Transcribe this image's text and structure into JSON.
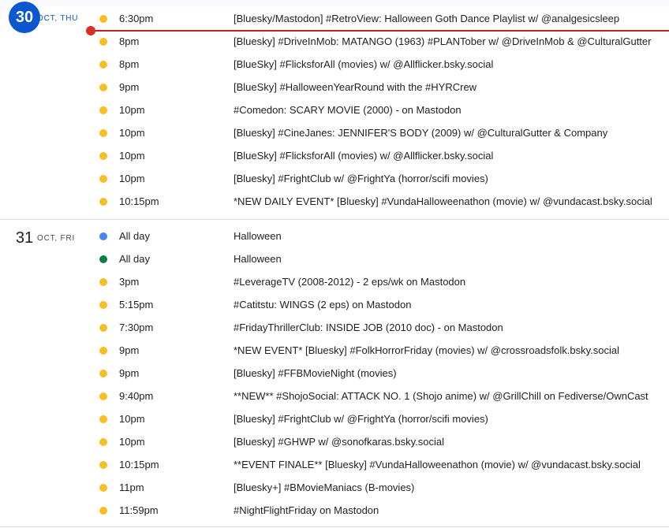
{
  "colors": {
    "yellow": "#f6bf26",
    "blue": "#4285f4",
    "green": "#0b8043",
    "today": "#0b57d0",
    "now": "#d93025"
  },
  "days": [
    {
      "num": "30",
      "label": "Oct, Thu",
      "events": [
        {
          "time": "6:30pm",
          "title": "[Bluesky/Mastodon] #RetroView: Halloween Goth Dance Playlist w/ @analgesicsleep",
          "color": "#f6bf26"
        },
        {
          "time": "8pm",
          "title": "[Bluesky] #DriveInMob: MATANGO (1963) #PLANTober w/ @DriveInMob & @CulturalGutter",
          "color": "#f6bf26"
        },
        {
          "time": "8pm",
          "title": "[BlueSky] #FlicksforAll (movies) w/ @Allflicker.bsky.social",
          "color": "#f6bf26"
        },
        {
          "time": "9pm",
          "title": "[BlueSky] #HalloweenYearRound with the #HYRCrew",
          "color": "#f6bf26"
        },
        {
          "time": "10pm",
          "title": "#Comedon: SCARY MOVIE (2000) - on Mastodon",
          "color": "#f6bf26"
        },
        {
          "time": "10pm",
          "title": "[Bluesky] #CineJanes: JENNIFER'S BODY (2009) w/ @CulturalGutter & Company",
          "color": "#f6bf26"
        },
        {
          "time": "10pm",
          "title": "[BlueSky] #FlicksforAll (movies) w/ @Allflicker.bsky.social",
          "color": "#f6bf26"
        },
        {
          "time": "10pm",
          "title": "[Bluesky] #FrightClub w/ @FrightYa (horror/scifi movies)",
          "color": "#f6bf26"
        },
        {
          "time": "10:15pm",
          "title": "*NEW DAILY EVENT* [Bluesky] #VundaHalloweenathon (movie) w/ @vundacast.bsky.social",
          "color": "#f6bf26"
        }
      ]
    },
    {
      "num": "31",
      "label": "Oct, Fri",
      "events": [
        {
          "time": "All day",
          "title": "Halloween",
          "color": "#4285f4"
        },
        {
          "time": "All day",
          "title": "Halloween",
          "color": "#0b8043"
        },
        {
          "time": "3pm",
          "title": "#LeverageTV (2008-2012) - 2 eps/wk on Mastodon",
          "color": "#f6bf26"
        },
        {
          "time": "5:15pm",
          "title": "#Catitstu: WINGS (2 eps) on Mastodon",
          "color": "#f6bf26"
        },
        {
          "time": "7:30pm",
          "title": "#FridayThrillerClub: INSIDE JOB (2010 doc) - on Mastodon",
          "color": "#f6bf26"
        },
        {
          "time": "9pm",
          "title": "*NEW EVENT* [Bluesky] #FolkHorrorFriday (movies) w/ @crossroadsfolk.bsky.social",
          "color": "#f6bf26"
        },
        {
          "time": "9pm",
          "title": "[Bluesky] #FFBMovieNight (movies)",
          "color": "#f6bf26"
        },
        {
          "time": "9:40pm",
          "title": "**NEW** #ShojoSocial: ATTACK NO. 1 (Shojo anime) w/ @GrillChill on Fediverse/OwnCast",
          "color": "#f6bf26"
        },
        {
          "time": "10pm",
          "title": "[Bluesky] #FrightClub w/ @FrightYa (horror/scifi movies)",
          "color": "#f6bf26"
        },
        {
          "time": "10pm",
          "title": "[Bluesky] #GHWP w/ @sonofkaras.bsky.social",
          "color": "#f6bf26"
        },
        {
          "time": "10:15pm",
          "title": "**EVENT FINALE** [Bluesky] #VundaHalloweenathon (movie) w/ @vundacast.bsky.social",
          "color": "#f6bf26"
        },
        {
          "time": "11pm",
          "title": "[Bluesky+] #BMovieManiacs (B-movies)",
          "color": "#f6bf26"
        },
        {
          "time": "11:59pm",
          "title": "#NightFlightFriday on Mastodon",
          "color": "#f6bf26"
        }
      ]
    }
  ]
}
